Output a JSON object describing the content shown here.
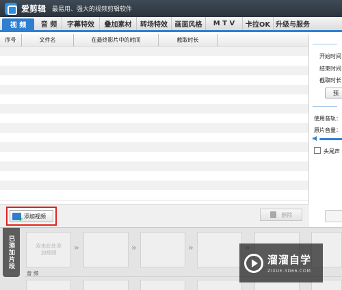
{
  "app": {
    "name": "爱剪辑",
    "slogan": "最易用、强大的视频剪辑软件"
  },
  "tabs": [
    {
      "label": "视 频",
      "active": true
    },
    {
      "label": "音 频"
    },
    {
      "label": "字幕特效"
    },
    {
      "label": "叠加素材"
    },
    {
      "label": "转场特效"
    },
    {
      "label": "画面风格"
    },
    {
      "label": "M T V"
    },
    {
      "label": "卡拉OK"
    },
    {
      "label": "升级与服务"
    }
  ],
  "video_table": {
    "columns": [
      "序号",
      "文件名",
      "在最终影片中的时间",
      "截取时长"
    ]
  },
  "buttons": {
    "add_video": "添加视频",
    "delete": "删除"
  },
  "right_panel": {
    "start_time": "开始时间",
    "end_time": "结束时间",
    "duration": "截取时长",
    "preview": "预",
    "use_track": "使用音轨：",
    "original_volume": "原片音量：",
    "head_tail": "头尾声"
  },
  "clip_area": {
    "side_tab": "已添加片段",
    "first_clip_hint": "双击此处添加视频",
    "audio_label": "音 频"
  },
  "watermark": {
    "title": "溜溜自学",
    "url": "ZIXUE.3D66.COM"
  },
  "colors": {
    "accent": "#2f7fd1",
    "highlight_border": "#e0211b",
    "title_bar": "#333c45"
  }
}
